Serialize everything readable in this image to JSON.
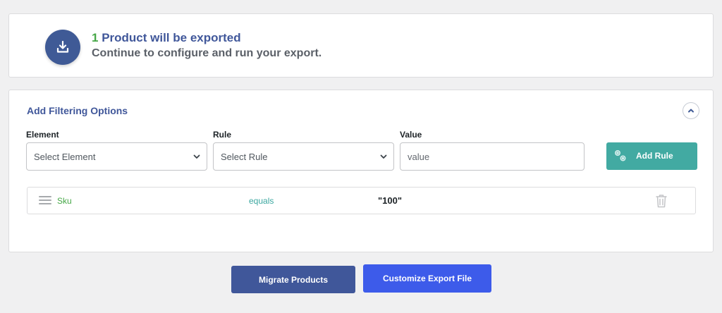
{
  "summary": {
    "count": "1",
    "title_rest": " Product will be exported",
    "subtitle": "Continue to configure and run your export.",
    "icon": "download-icon"
  },
  "filter": {
    "title": "Add Filtering Options",
    "collapse_icon": "chevron-up-icon",
    "element_label": "Element",
    "element_placeholder": "Select Element",
    "rule_label": "Rule",
    "rule_placeholder": "Select Rule",
    "value_label": "Value",
    "value_placeholder": "value",
    "add_rule_label": "Add Rule",
    "add_rule_icon": "gears-icon",
    "rules": [
      {
        "element": "Sku",
        "operator": "equals",
        "value": "\"100\""
      }
    ]
  },
  "actions": {
    "migrate_label": "Migrate Products",
    "customize_label": "Customize Export File"
  },
  "colors": {
    "primary": "#40579a",
    "teal": "#42aaa2",
    "green": "#46a747",
    "blue": "#3d5bea"
  }
}
